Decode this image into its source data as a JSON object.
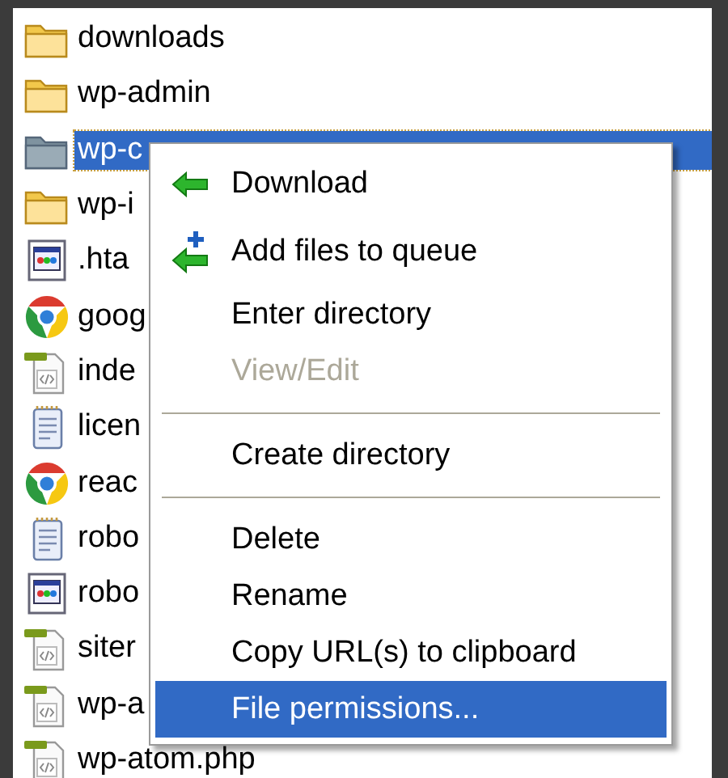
{
  "files": [
    {
      "name": "downloads",
      "kind": "folder",
      "selected": false
    },
    {
      "name": "wp-admin",
      "kind": "folder",
      "selected": false
    },
    {
      "name": "wp-c",
      "kind": "folder",
      "selected": true
    },
    {
      "name": "wp-i",
      "kind": "folder",
      "selected": false
    },
    {
      "name": ".hta",
      "kind": "window",
      "selected": false
    },
    {
      "name": "goog",
      "kind": "browser",
      "selected": false
    },
    {
      "name": "inde",
      "kind": "code",
      "selected": false
    },
    {
      "name": "licen",
      "kind": "text",
      "selected": false
    },
    {
      "name": "reac",
      "kind": "browser",
      "selected": false
    },
    {
      "name": "robo",
      "kind": "text",
      "selected": false
    },
    {
      "name": "robo",
      "kind": "window",
      "selected": false
    },
    {
      "name": "siter",
      "kind": "code",
      "selected": false
    },
    {
      "name": "wp-a",
      "kind": "code",
      "selected": false
    },
    {
      "name": "wp-atom.php",
      "kind": "code",
      "selected": false
    }
  ],
  "context_menu": [
    {
      "kind": "download",
      "label": "Download",
      "disabled": false,
      "selected": false
    },
    {
      "kind": "queue",
      "label": "Add files to queue",
      "disabled": false,
      "selected": false
    },
    {
      "kind": "item",
      "label": "Enter directory",
      "disabled": false,
      "selected": false
    },
    {
      "kind": "item",
      "label": "View/Edit",
      "disabled": true,
      "selected": false
    },
    {
      "kind": "separator"
    },
    {
      "kind": "item",
      "label": "Create directory",
      "disabled": false,
      "selected": false
    },
    {
      "kind": "separator"
    },
    {
      "kind": "item",
      "label": "Delete",
      "disabled": false,
      "selected": false
    },
    {
      "kind": "item",
      "label": "Rename",
      "disabled": false,
      "selected": false
    },
    {
      "kind": "item",
      "label": "Copy URL(s) to clipboard",
      "disabled": false,
      "selected": false
    },
    {
      "kind": "item",
      "label": "File permissions...",
      "disabled": false,
      "selected": true
    }
  ]
}
